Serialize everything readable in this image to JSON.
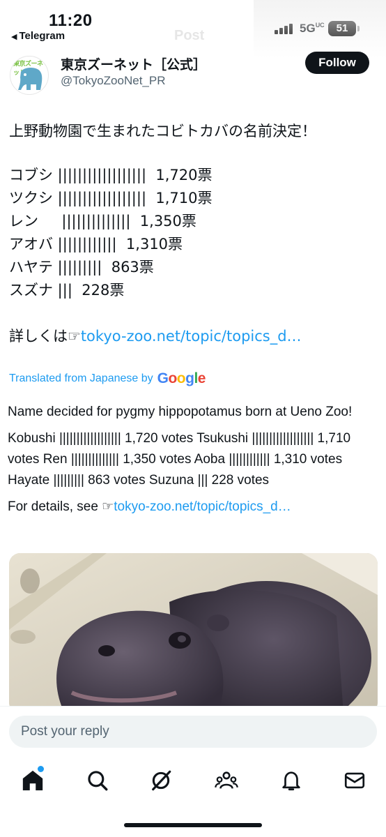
{
  "status_bar": {
    "time": "11:20",
    "back_app": "Telegram",
    "network": "5G",
    "network_sub": "UC",
    "battery": "51"
  },
  "header": {
    "title": "Post"
  },
  "author": {
    "display_name": "東京ズーネット［公式］",
    "handle": "@TokyoZooNet_PR",
    "avatar_text": "東京ズーネット",
    "follow_label": "Follow"
  },
  "tweet_ja": {
    "headline": "上野動物園で生まれたコビトカバの名前決定！",
    "votes": [
      "コブシ ||||||||||||||||||  1,720票",
      "ツクシ ||||||||||||||||||  1,710票",
      "レン     ||||||||||||||  1,350票",
      "アオバ ||||||||||||  1,310票",
      "ハヤテ |||||||||  863票",
      "スズナ |||  228票"
    ],
    "details_prefix": "詳しくは☞",
    "details_link": "tokyo-zoo.net/topic/topics_d…"
  },
  "translation": {
    "label": "Translated from Japanese by",
    "provider": "Google",
    "headline": "Name decided for pygmy hippopotamus born at Ueno Zoo!",
    "votes_text": "Kobushi |||||||||||||||||| 1,720 votes Tsukushi |||||||||||||||||| 1,710 votes Ren |||||||||||||| 1,350 votes Aoba |||||||||||| 1,310 votes Hayate |||||||||  863 votes Suzuna ||| 228 votes",
    "details_prefix": "For details, see ☞",
    "details_link": "tokyo-zoo.net/topic/topics_d…"
  },
  "reply": {
    "placeholder": "Post your reply"
  },
  "nav": {
    "items": [
      "home-icon",
      "search-icon",
      "grok-icon",
      "communities-icon",
      "notifications-icon",
      "messages-icon"
    ]
  },
  "colors": {
    "accent": "#1d9bf0",
    "text": "#0f1419",
    "secondary": "#536471"
  }
}
